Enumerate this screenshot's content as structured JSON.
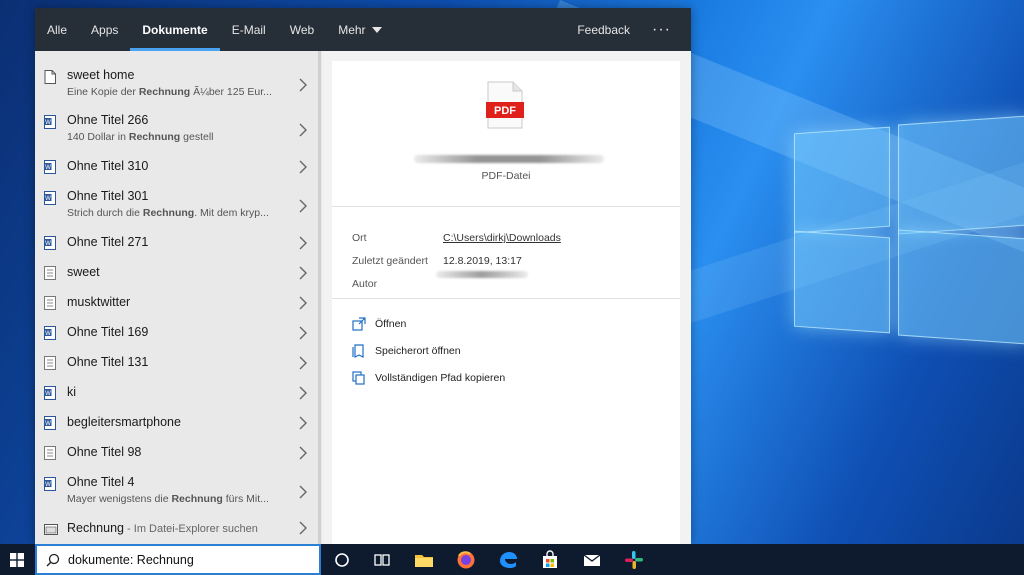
{
  "nav": {
    "tabs": [
      {
        "label": "Alle"
      },
      {
        "label": "Apps"
      },
      {
        "label": "Dokumente"
      },
      {
        "label": "E-Mail"
      },
      {
        "label": "Web"
      },
      {
        "label": "Mehr"
      }
    ],
    "active_tab": "Dokumente",
    "feedback_label": "Feedback",
    "more_label": "···"
  },
  "results": [
    {
      "title": "sweet home",
      "subtitle_pre": "Eine Kopie der ",
      "subtitle_bold": "Rechnung",
      "subtitle_post": " Ã¼ber 125 Eur...",
      "icon": "document-icon"
    },
    {
      "title": "Ohne Titel 266",
      "subtitle_pre": "140 Dollar in ",
      "subtitle_bold": "Rechnung",
      "subtitle_post": " gestell",
      "icon": "word-document-icon"
    },
    {
      "title": "Ohne Titel 310",
      "icon": "word-document-icon"
    },
    {
      "title": "Ohne Titel 301",
      "subtitle_pre": "Strich durch die ",
      "subtitle_bold": "Rechnung",
      "subtitle_post": ". Mit dem kryp...",
      "icon": "word-document-icon"
    },
    {
      "title": "Ohne Titel 271",
      "icon": "word-document-icon"
    },
    {
      "title": "sweet",
      "icon": "text-document-icon"
    },
    {
      "title": "musktwitter",
      "icon": "text-document-icon"
    },
    {
      "title": "Ohne Titel 169",
      "icon": "word-document-icon"
    },
    {
      "title": "Ohne Titel 131",
      "icon": "text-document-icon"
    },
    {
      "title": "ki",
      "icon": "word-document-icon"
    },
    {
      "title": "begleitersmartphone",
      "icon": "word-document-icon"
    },
    {
      "title": "Ohne Titel 98",
      "icon": "text-document-icon"
    },
    {
      "title": "Ohne Titel 4",
      "subtitle_pre": "Mayer wenigstens die ",
      "subtitle_bold": "Rechnung",
      "subtitle_post": " fürs Mit...",
      "icon": "word-document-icon"
    },
    {
      "title": "Rechnung",
      "title_suffix": " - Im Datei-Explorer suchen",
      "icon": "file-explorer-icon"
    }
  ],
  "detail": {
    "icon_label": "PDF",
    "file_type": "PDF-Datei",
    "props": {
      "location_label": "Ort",
      "location_value": "C:\\Users\\dirkj\\Downloads",
      "modified_label": "Zuletzt geändert",
      "modified_value": "12.8.2019, 13:17",
      "author_label": "Autor"
    },
    "actions": [
      {
        "label": "Öffnen",
        "icon": "open-icon"
      },
      {
        "label": "Speicherort öffnen",
        "icon": "folder-location-icon"
      },
      {
        "label": "Vollständigen Pfad kopieren",
        "icon": "copy-path-icon"
      }
    ]
  },
  "taskbar": {
    "search_value": "dokumente: Rechnung",
    "icons": [
      "windows-start-icon",
      "cortana-icon",
      "task-view-icon",
      "file-explorer-icon",
      "firefox-icon",
      "edge-icon",
      "store-icon",
      "mail-icon",
      "slack-icon"
    ]
  },
  "colors": {
    "nav_bg": "#262e38",
    "active_underline": "#4aa3f2",
    "taskbar_bg": "#0e1b2e",
    "pdf_red": "#e0201b",
    "action_blue": "#1f6fc5"
  }
}
